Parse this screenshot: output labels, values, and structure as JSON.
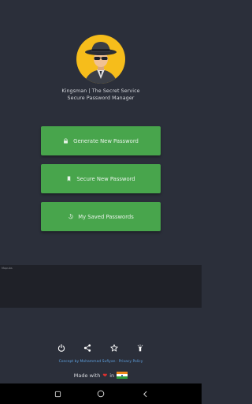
{
  "app": {
    "title_line1": "Kingsman | The Secret Service",
    "title_line2": "Secure Password Manager"
  },
  "buttons": {
    "generate": {
      "label": "Generate New Password",
      "icon": "lock-icon"
    },
    "secure": {
      "label": "Secure New Password",
      "icon": "bookmark-icon"
    },
    "saved": {
      "label": "My Saved Passwords",
      "icon": "history-icon"
    }
  },
  "ad": {
    "label": "Mopubs"
  },
  "footer": {
    "icons": [
      "power-icon",
      "share-icon",
      "star-icon",
      "flashlight-icon"
    ],
    "credit": "Concept by Mohammad Sufiyan",
    "separator": "·",
    "privacy": "Privacy Policy",
    "made_with": "Made with",
    "made_in": "in"
  },
  "colors": {
    "background": "#2b2f3a",
    "button": "#48a54c",
    "logo_circle": "#f6bd1b",
    "link": "#5ea0df",
    "heart": "#e0312f"
  }
}
